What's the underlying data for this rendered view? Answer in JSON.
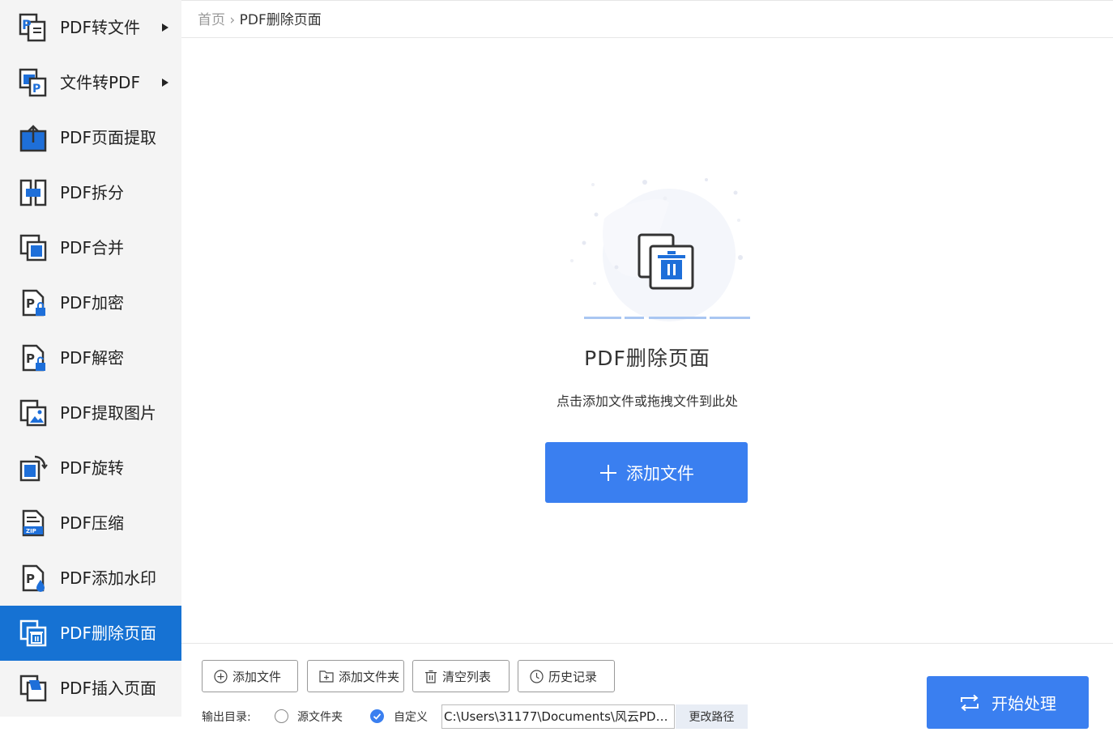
{
  "sidebar": {
    "items": [
      {
        "label": "PDF转文件",
        "icon": "pdf-to-file-icon",
        "has_submenu": true
      },
      {
        "label": "文件转PDF",
        "icon": "file-to-pdf-icon",
        "has_submenu": true
      },
      {
        "label": "PDF页面提取",
        "icon": "page-extract-icon"
      },
      {
        "label": "PDF拆分",
        "icon": "split-icon"
      },
      {
        "label": "PDF合并",
        "icon": "merge-icon"
      },
      {
        "label": "PDF加密",
        "icon": "lock-icon"
      },
      {
        "label": "PDF解密",
        "icon": "unlock-icon"
      },
      {
        "label": "PDF提取图片",
        "icon": "image-extract-icon"
      },
      {
        "label": "PDF旋转",
        "icon": "rotate-icon"
      },
      {
        "label": "PDF压缩",
        "icon": "zip-icon"
      },
      {
        "label": "PDF添加水印",
        "icon": "watermark-icon"
      },
      {
        "label": "PDF删除页面",
        "icon": "delete-page-icon",
        "active": true
      },
      {
        "label": "PDF插入页面",
        "icon": "insert-page-icon"
      }
    ]
  },
  "breadcrumb": {
    "home": "首页",
    "separator": "›",
    "current": "PDF删除页面"
  },
  "dropzone": {
    "title": "PDF删除页面",
    "hint": "点击添加文件或拖拽文件到此处",
    "add_button": "添加文件"
  },
  "toolbar": {
    "add_file": "添加文件",
    "add_folder": "添加文件夹",
    "clear_list": "清空列表",
    "history": "历史记录"
  },
  "output": {
    "label": "输出目录:",
    "option_source": "源文件夹",
    "option_custom": "自定义",
    "selected": "自定义",
    "path": "C:\\Users\\31177\\Documents\\风云PDF...",
    "change_path": "更改路径"
  },
  "start_button": "开始处理",
  "colors": {
    "accent": "#3a7ff0",
    "active_nav": "#1672d3"
  }
}
